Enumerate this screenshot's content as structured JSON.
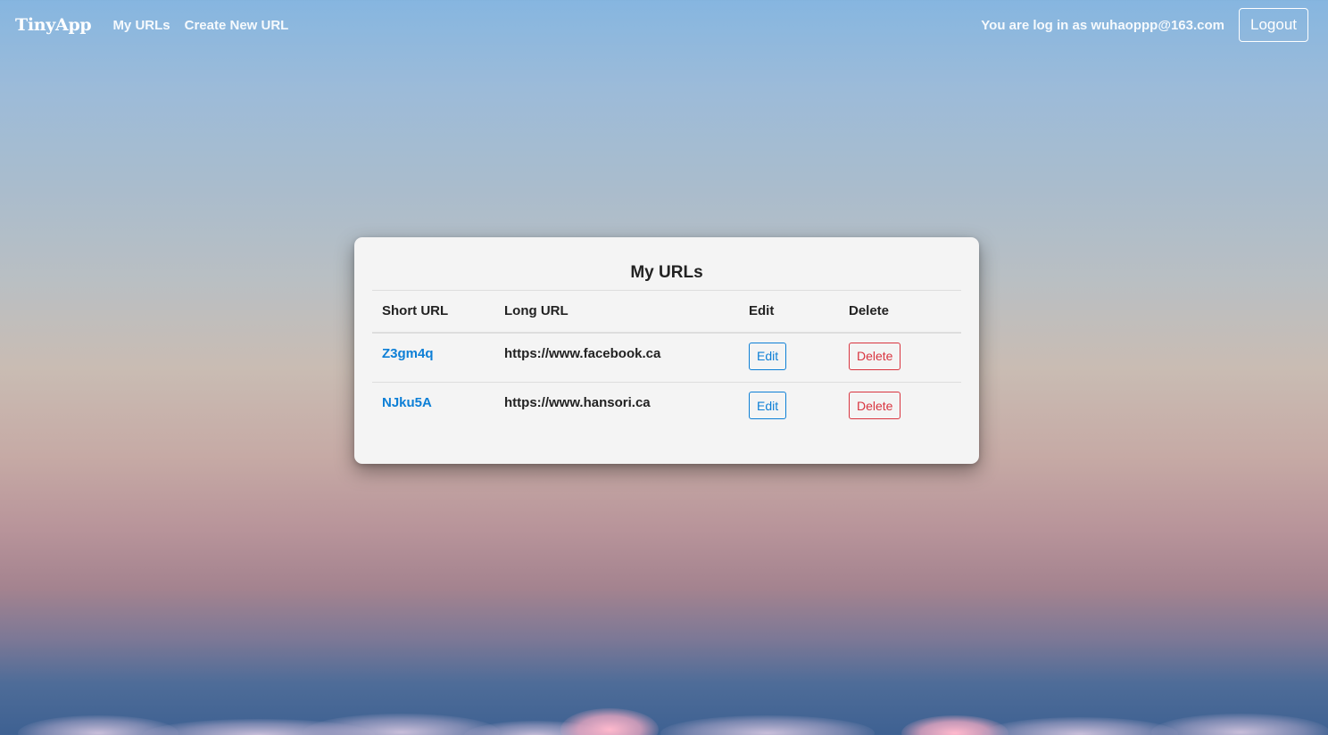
{
  "nav": {
    "brand": "TinyApp",
    "my_urls": "My URLs",
    "create_new": "Create New URL",
    "login_status": "You are log in as wuhaoppp@163.com",
    "logout": "Logout"
  },
  "card": {
    "title": "My URLs",
    "columns": [
      "Short URL",
      "Long URL",
      "Edit",
      "Delete"
    ],
    "rows": [
      {
        "short_url": "Z3gm4q",
        "long_url": "https://www.facebook.ca",
        "edit": "Edit",
        "delete": "Delete"
      },
      {
        "short_url": "NJku5A",
        "long_url": "https://www.hansori.ca",
        "edit": "Edit",
        "delete": "Delete"
      }
    ]
  },
  "colors": {
    "link_blue": "#0d7fd6",
    "delete_red": "#d9343f",
    "card_bg": "#f4f4f4"
  }
}
